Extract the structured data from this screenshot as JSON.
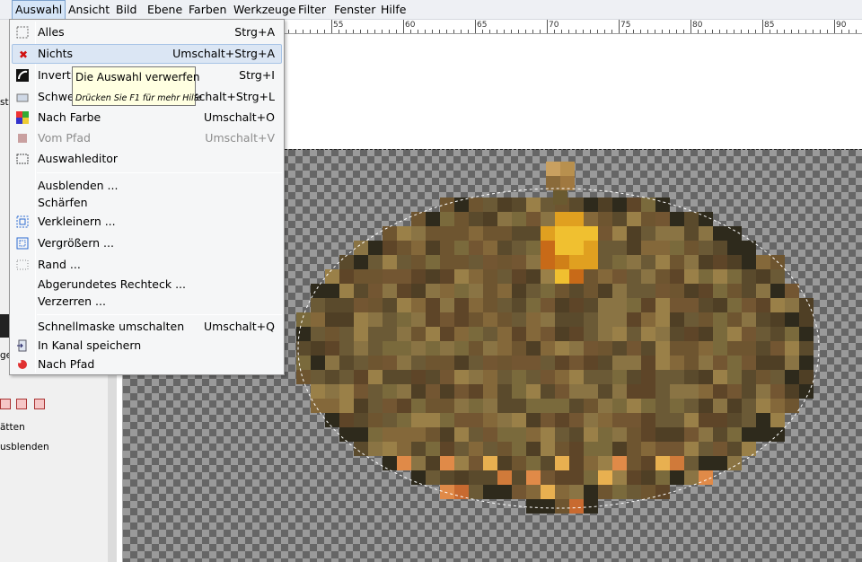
{
  "menubar": {
    "items": [
      {
        "label": "Auswahl"
      },
      {
        "label": "Ansicht"
      },
      {
        "label": "Bild"
      },
      {
        "label": "Ebene"
      },
      {
        "label": "Farben"
      },
      {
        "label": "Werkzeuge"
      },
      {
        "label": "Filter"
      },
      {
        "label": "Fenster"
      },
      {
        "label": "Hilfe"
      }
    ]
  },
  "ruler": {
    "labels": [
      "55",
      "60",
      "65",
      "70",
      "75",
      "80",
      "85",
      "90"
    ]
  },
  "toolbox": {
    "fragments": [
      "ste",
      "ge",
      "ätten",
      "usblenden"
    ]
  },
  "menu": {
    "items": [
      {
        "label": "Alles",
        "shortcut": "Strg+A",
        "icon": "select-all-icon"
      },
      {
        "label": "Nichts",
        "shortcut": "Umschalt+Strg+A",
        "icon": "select-none-icon"
      },
      {
        "label": "Invertie",
        "shortcut": "Strg+I",
        "icon": "invert-icon"
      },
      {
        "label": "Schweb",
        "shortcut": "Umschalt+Strg+L",
        "icon": "float-icon"
      },
      {
        "label": "Nach Farbe",
        "shortcut": "Umschalt+O",
        "icon": "by-color-icon"
      },
      {
        "label": "Vom Pfad",
        "shortcut": "Umschalt+V",
        "icon": "from-path-icon"
      },
      {
        "label": "Auswahleditor",
        "shortcut": "",
        "icon": "selection-editor-icon"
      },
      {
        "label": "Ausblenden ...",
        "shortcut": "",
        "icon": ""
      },
      {
        "label": "Schärfen",
        "shortcut": "",
        "icon": ""
      },
      {
        "label": "Verkleinern ...",
        "shortcut": "",
        "icon": "shrink-icon"
      },
      {
        "label": "Vergrößern ...",
        "shortcut": "",
        "icon": "grow-icon"
      },
      {
        "label": "Rand ...",
        "shortcut": "",
        "icon": "border-icon"
      },
      {
        "label": "Abgerundetes Rechteck ...",
        "shortcut": "",
        "icon": ""
      },
      {
        "label": "Verzerren ...",
        "shortcut": "",
        "icon": ""
      },
      {
        "label": "Schnellmaske umschalten",
        "shortcut": "Umschalt+Q",
        "icon": ""
      },
      {
        "label": "In Kanal speichern",
        "shortcut": "",
        "icon": "save-channel-icon"
      },
      {
        "label": "Nach Pfad",
        "shortcut": "",
        "icon": "to-path-icon"
      }
    ]
  },
  "tooltip": {
    "main": "Die Auswahl verwerfen",
    "sub": "Drücken Sie F1 für mehr Hilfe"
  },
  "colors": {
    "menu_hover": "#dbe6f4",
    "tooltip_bg": "#ffffe1",
    "select_none_red": "#d01010"
  }
}
